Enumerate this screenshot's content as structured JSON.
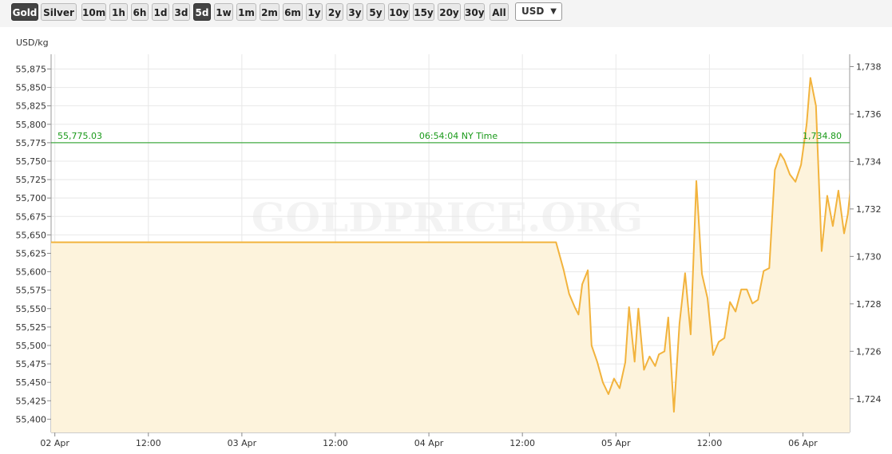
{
  "toolbar": {
    "metals": [
      {
        "label": "Gold",
        "active": true
      },
      {
        "label": "Silver",
        "active": false
      }
    ],
    "ranges": [
      {
        "label": "10m",
        "active": false
      },
      {
        "label": "1h",
        "active": false
      },
      {
        "label": "6h",
        "active": false
      },
      {
        "label": "1d",
        "active": false
      },
      {
        "label": "3d",
        "active": false
      },
      {
        "label": "5d",
        "active": true
      },
      {
        "label": "1w",
        "active": false
      },
      {
        "label": "1m",
        "active": false
      },
      {
        "label": "2m",
        "active": false
      },
      {
        "label": "6m",
        "active": false
      },
      {
        "label": "1y",
        "active": false
      },
      {
        "label": "2y",
        "active": false
      },
      {
        "label": "3y",
        "active": false
      },
      {
        "label": "5y",
        "active": false
      },
      {
        "label": "10y",
        "active": false
      },
      {
        "label": "15y",
        "active": false
      },
      {
        "label": "20y",
        "active": false
      },
      {
        "label": "30y",
        "active": false
      },
      {
        "label": "All",
        "active": false
      }
    ],
    "currency": "USD"
  },
  "colors": {
    "line": "#f2b33d",
    "fill": "#fdf3dc",
    "current_line": "#1a9a1a",
    "grid": "#e8e8e8"
  },
  "chart_data": {
    "type": "area",
    "watermark": "GOLDPRICE.ORG",
    "ylabel": "USD/kg",
    "x_ticks": [
      {
        "label": "02 Apr",
        "x": 0
      },
      {
        "label": "12:00",
        "x": 0.5
      },
      {
        "label": "03 Apr",
        "x": 1
      },
      {
        "label": "12:00",
        "x": 1.5
      },
      {
        "label": "04 Apr",
        "x": 2
      },
      {
        "label": "12:00",
        "x": 2.5
      },
      {
        "label": "05 Apr",
        "x": 3
      },
      {
        "label": "12:00",
        "x": 3.5
      },
      {
        "label": "06 Apr",
        "x": 4
      }
    ],
    "x_range": [
      -0.02,
      4.25
    ],
    "y_left": {
      "range": [
        55382,
        55895
      ],
      "ticks": [
        55875,
        55850,
        55825,
        55800,
        55775,
        55750,
        55725,
        55700,
        55675,
        55650,
        55625,
        55600,
        55575,
        55550,
        55525,
        55500,
        55475,
        55450,
        55425,
        55400
      ]
    },
    "y_right": {
      "range": [
        1722.58,
        1738.52
      ],
      "ticks": [
        1738,
        1736,
        1734,
        1732,
        1730,
        1728,
        1726,
        1724
      ]
    },
    "current": {
      "value_left": "55,775.03",
      "value_right": "1,734.80",
      "value": 55775.03,
      "time_label": "06:54:04 NY Time"
    },
    "series": [
      {
        "values": [
          [
            -0.02,
            55640
          ],
          [
            2.68,
            55640
          ],
          [
            2.72,
            55603
          ],
          [
            2.75,
            55570
          ],
          [
            2.78,
            55552
          ],
          [
            2.8,
            55542
          ],
          [
            2.82,
            55583
          ],
          [
            2.85,
            55602
          ],
          [
            2.87,
            55500
          ],
          [
            2.9,
            55478
          ],
          [
            2.93,
            55450
          ],
          [
            2.96,
            55434
          ],
          [
            2.99,
            55455
          ],
          [
            3.02,
            55442
          ],
          [
            3.05,
            55477
          ],
          [
            3.07,
            55552
          ],
          [
            3.1,
            55478
          ],
          [
            3.12,
            55550
          ],
          [
            3.15,
            55467
          ],
          [
            3.18,
            55485
          ],
          [
            3.21,
            55472
          ],
          [
            3.23,
            55488
          ],
          [
            3.26,
            55492
          ],
          [
            3.28,
            55538
          ],
          [
            3.31,
            55410
          ],
          [
            3.34,
            55530
          ],
          [
            3.37,
            55598
          ],
          [
            3.4,
            55515
          ],
          [
            3.43,
            55723
          ],
          [
            3.46,
            55597
          ],
          [
            3.49,
            55564
          ],
          [
            3.52,
            55487
          ],
          [
            3.55,
            55505
          ],
          [
            3.58,
            55510
          ],
          [
            3.61,
            55559
          ],
          [
            3.64,
            55546
          ],
          [
            3.67,
            55576
          ],
          [
            3.7,
            55576
          ],
          [
            3.73,
            55557
          ],
          [
            3.76,
            55562
          ],
          [
            3.79,
            55601
          ],
          [
            3.82,
            55605
          ],
          [
            3.85,
            55738
          ],
          [
            3.88,
            55760
          ],
          [
            3.9,
            55752
          ],
          [
            3.93,
            55732
          ],
          [
            3.96,
            55722
          ],
          [
            3.99,
            55745
          ],
          [
            4.02,
            55800
          ],
          [
            4.04,
            55863
          ],
          [
            4.07,
            55825
          ],
          [
            4.1,
            55628
          ],
          [
            4.13,
            55703
          ],
          [
            4.16,
            55662
          ],
          [
            4.19,
            55710
          ],
          [
            4.22,
            55652
          ],
          [
            4.24,
            55678
          ],
          [
            4.27,
            55750
          ],
          [
            4.29,
            55777
          ]
        ]
      }
    ]
  }
}
